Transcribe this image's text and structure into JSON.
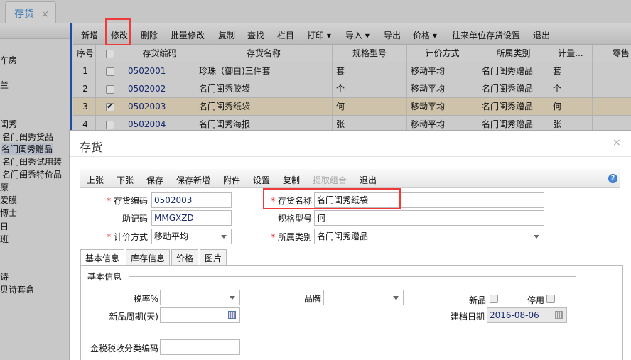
{
  "tab": {
    "title": "存货",
    "close": "×"
  },
  "sidebar": {
    "items": [
      "车房",
      "兰",
      "闺秀",
      "名门闺秀货品",
      "名门闺秀赠品",
      "名门闺秀试用装",
      "名门闺秀特价品",
      "原",
      "爱膜",
      "博士",
      "日",
      "班",
      "诗",
      "贝诗套盒"
    ],
    "selected": "名门闺秀赠品"
  },
  "toolbar": [
    "新增",
    "修改",
    "删除",
    "批量修改",
    "复制",
    "查找",
    "栏目",
    "打印 ▾",
    "导入 ▾",
    "导出",
    "价格 ▾",
    "往来单位存货设置",
    "退出"
  ],
  "grid": {
    "headers": [
      "序号",
      "",
      "存货编码",
      "存货名称",
      "规格型号",
      "计价方式",
      "所属类别",
      "计量...",
      "零售"
    ],
    "rows": [
      {
        "no": "1",
        "checked": false,
        "code": "0502001",
        "name": "珍珠（御白)三件套",
        "spec": "套",
        "pricing": "移动平均",
        "category": "名门闺秀赠品",
        "unit": "套"
      },
      {
        "no": "2",
        "checked": false,
        "code": "0502002",
        "name": "名门闺秀胶袋",
        "spec": "个",
        "pricing": "移动平均",
        "category": "名门闺秀赠品",
        "unit": "个"
      },
      {
        "no": "3",
        "checked": true,
        "code": "0502003",
        "name": "名门闺秀纸袋",
        "spec": "何",
        "pricing": "移动平均",
        "category": "名门闺秀赠品",
        "unit": "何"
      },
      {
        "no": "4",
        "checked": false,
        "code": "0502004",
        "name": "名门闺秀海报",
        "spec": "张",
        "pricing": "移动平均",
        "category": "名门闺秀赠品",
        "unit": "张"
      }
    ]
  },
  "dialog": {
    "title": "存货",
    "close": "×",
    "toolbar": [
      "上张",
      "下张",
      "保存",
      "保存新增",
      "附件",
      "设置",
      "复制",
      "提取组合",
      "退出"
    ],
    "fields": {
      "code_label": "存货编码",
      "code": "0502003",
      "name_label": "存货名称",
      "name": "名门闺秀纸袋",
      "mnemonic_label": "助记码",
      "mnemonic": "MMGXZD",
      "spec_label": "规格型号",
      "spec": "何",
      "pricing_label": "计价方式",
      "pricing": "移动平均",
      "category_label": "所属类别",
      "category": "名门闺秀赠品"
    },
    "tabs": [
      "基本信息",
      "库存信息",
      "价格",
      "图片"
    ],
    "basic": {
      "legend": "基本信息",
      "tax_label": "税率%",
      "tax": "",
      "brand_label": "品牌",
      "brand": "",
      "new_label": "新品",
      "disabled_label": "停用",
      "cycle_label": "新品周期(天)",
      "cycle": "",
      "date_label": "建档日期",
      "date": "2016-08-06",
      "taxcode_label": "金税税收分类编码",
      "taxcode": ""
    }
  },
  "colors": {
    "highlight": "#ee3a3a",
    "selected_row": "#cfc2aa",
    "accent": "#1d4f9c"
  }
}
